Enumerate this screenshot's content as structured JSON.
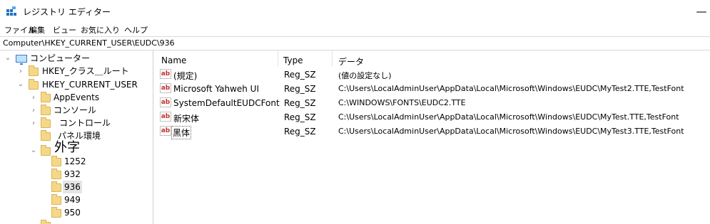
{
  "window": {
    "title": "レジストリ エディター",
    "close_glyph": "—"
  },
  "menu": [
    "ファイル",
    "編集",
    "ビュー",
    "お気に入り",
    "ヘルプ"
  ],
  "address": "Computer\\HKEY_CURRENT_USER\\EUDC\\936",
  "tree": {
    "root": "コンピューター",
    "items": [
      {
        "label": "HKEY_クラス＿ルート",
        "level": 1,
        "expander": "›"
      },
      {
        "label": "HKEY_CURRENT_USER",
        "level": 1,
        "expander": "⌄"
      },
      {
        "label": "AppEvents",
        "level": 2,
        "expander": "›"
      },
      {
        "label": "コンソール",
        "level": 2,
        "expander": "›"
      },
      {
        "label": "コントロール",
        "level": 2,
        "expander": "›"
      },
      {
        "label": "パネル環境",
        "level": 2,
        "expander": ""
      },
      {
        "label": "外字",
        "level": 2,
        "expander": "⌄",
        "large": true
      },
      {
        "label": "1252",
        "level": 3,
        "expander": ""
      },
      {
        "label": "932",
        "level": 3,
        "expander": ""
      },
      {
        "label": "936",
        "level": 3,
        "expander": "",
        "selected": true
      },
      {
        "label": "949",
        "level": 3,
        "expander": ""
      },
      {
        "label": "950",
        "level": 3,
        "expander": ""
      }
    ]
  },
  "columns": {
    "name": "Name",
    "type": "Type",
    "data": "データ"
  },
  "values": [
    {
      "icon": "ab",
      "name": "(規定)",
      "type": "Reg_SZ",
      "data": "(値の設定なし)"
    },
    {
      "icon": "ab",
      "name": "Microsoft Yahweh UI",
      "type": "Reg_SZ",
      "data": "C:\\Users\\LocalAdminUser\\AppData\\Local\\Microsoft\\Windows\\EUDC\\MyTest2.TTE,TestFont"
    },
    {
      "icon": "ab",
      "name": "SystemDefaultEUDCFont",
      "type": "Reg_SZ",
      "data": "C:\\WINDOWS\\FONTS\\EUDC2.TTE"
    },
    {
      "icon": "ab",
      "name": "新宋体",
      "type": "Reg_SZ",
      "data": "C:\\Users\\LocalAdminUser\\AppData\\Local\\Microsoft\\Windows\\EUDC\\MyTest.TTE,TestFont"
    },
    {
      "icon": "ab",
      "name": "黑体",
      "type": "Reg_SZ",
      "data": "C:\\Users\\LocalAdminUser\\AppData\\Local\\Microsoft\\Windows\\EUDC\\MyTest3.TTE,TestFont",
      "focused": true
    }
  ]
}
